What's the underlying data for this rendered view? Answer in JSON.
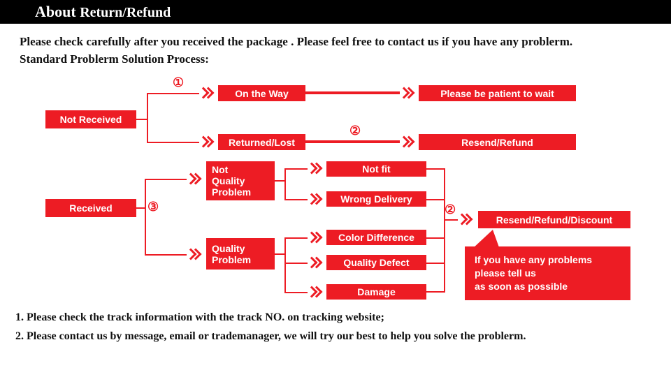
{
  "header": {
    "title_prefix": "About",
    "title_suffix": "Return/Refund"
  },
  "intro": {
    "line1": "Please check carefully after you received the package . Please feel free to contact us if you have any problerm.",
    "line2": "Standard Problerm Solution Process:"
  },
  "steps": {
    "s1": "①",
    "s2a": "②",
    "s2b": "②",
    "s3": "③"
  },
  "nodes": {
    "not_received": "Not Received",
    "on_the_way": "On the Way",
    "returned_lost": "Returned/Lost",
    "please_wait": "Please be patient to wait",
    "resend_refund": "Resend/Refund",
    "received": "Received",
    "not_quality": "Not\nQuality\nProblem",
    "quality": "Quality\nProblem",
    "not_fit": "Not fit",
    "wrong_delivery": "Wrong Delivery",
    "color_diff": "Color Difference",
    "quality_defect": "Quality Defect",
    "damage": "Damage",
    "resend_refund_discount": "Resend/Refund/Discount"
  },
  "callout": {
    "l1": "If you have any problems",
    "l2": "please tell us",
    "l3": "as soon as possible"
  },
  "footer": {
    "f1": "1. Please check the track information with the track NO. on tracking website;",
    "f2": "2. Please contact us by message, email or trademanager, we will try our best to help you solve the problerm."
  }
}
